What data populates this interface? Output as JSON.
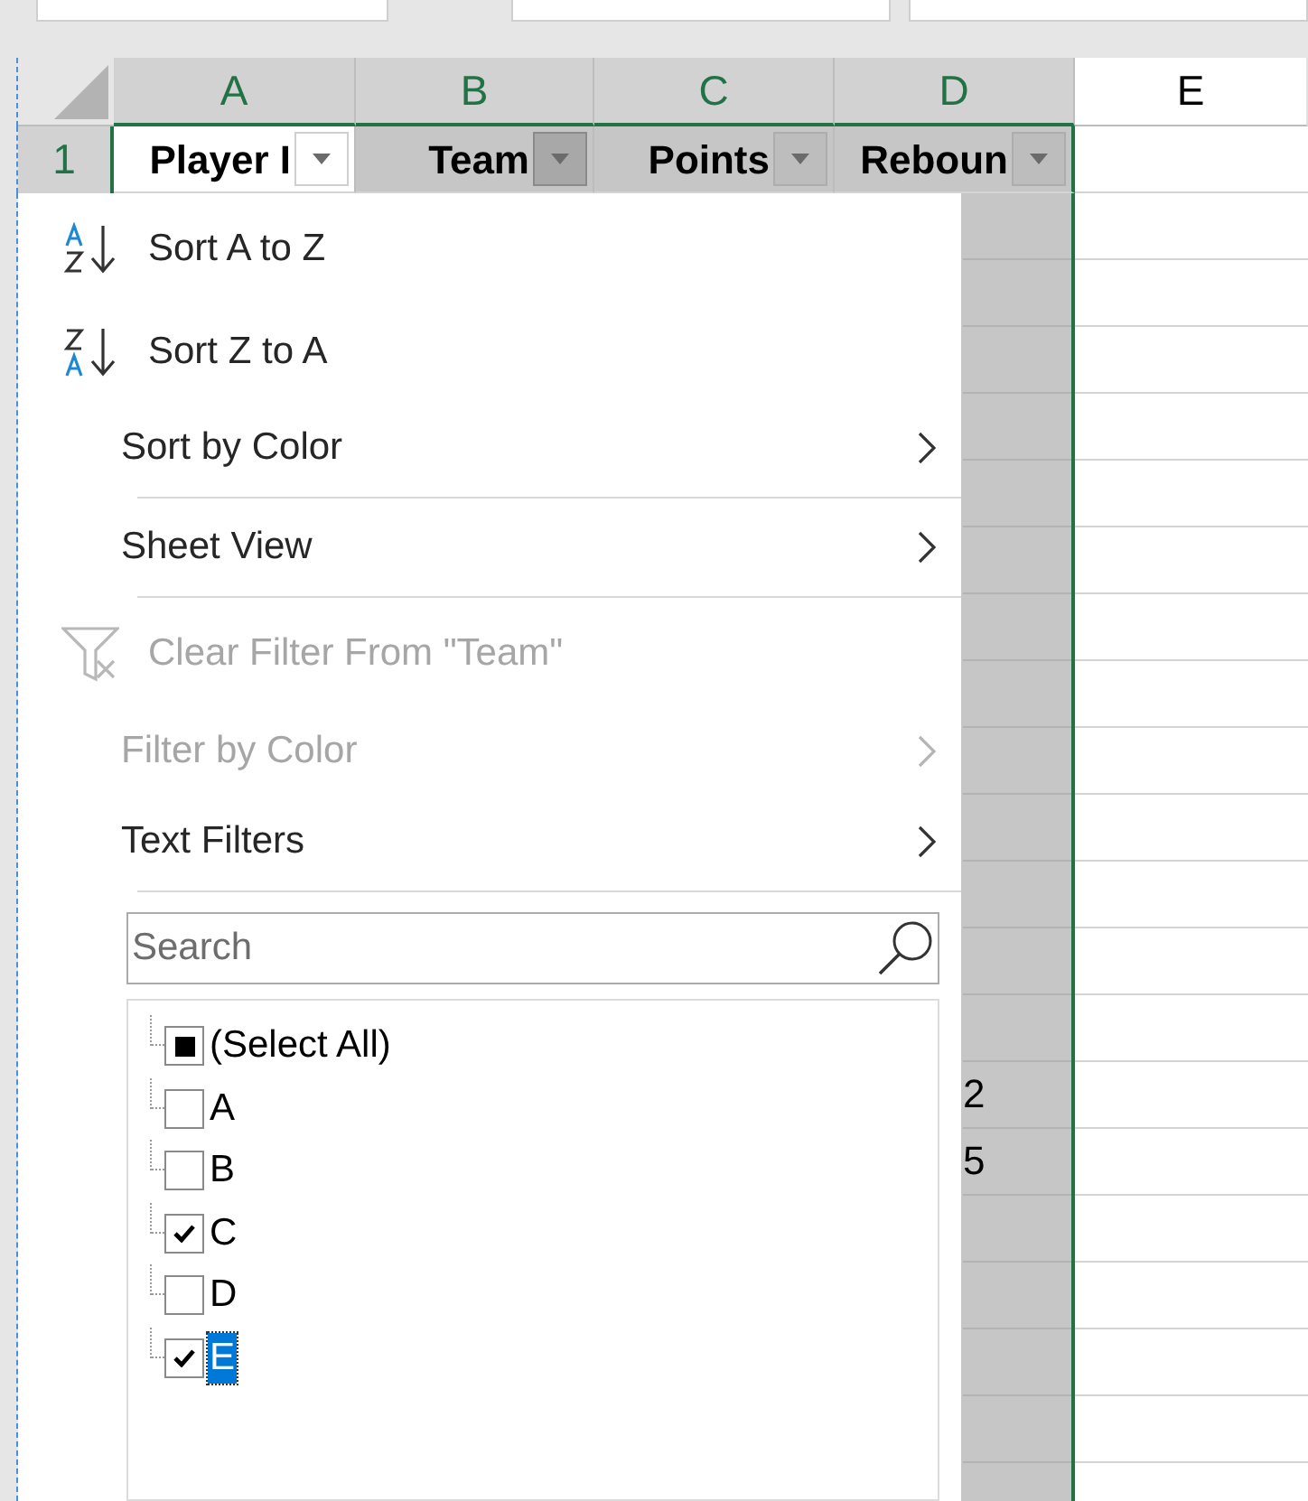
{
  "columns": [
    {
      "letter": "A",
      "selected": true
    },
    {
      "letter": "B",
      "selected": true
    },
    {
      "letter": "C",
      "selected": true
    },
    {
      "letter": "D",
      "selected": true
    },
    {
      "letter": "E",
      "selected": false
    }
  ],
  "header_row": {
    "number": "1",
    "cells": [
      {
        "text": "Player I",
        "filter_active": false
      },
      {
        "text": "Team",
        "filter_active": true
      },
      {
        "text": "Points",
        "filter_active": false
      },
      {
        "text": "Reboun",
        "filter_active": false
      }
    ]
  },
  "filter_menu": {
    "items": [
      {
        "kind": "sort_ascending",
        "label": "Sort A to Z",
        "disabled": false,
        "submenu": false
      },
      {
        "kind": "sort_descending",
        "label": "Sort Z to A",
        "disabled": false,
        "submenu": false
      },
      {
        "kind": "item",
        "label": "Sort by Color",
        "disabled": false,
        "submenu": true
      },
      {
        "kind": "separator"
      },
      {
        "kind": "item",
        "label": "Sheet View",
        "disabled": false,
        "submenu": true
      },
      {
        "kind": "separator"
      },
      {
        "kind": "clear",
        "label": "Clear Filter From \"Team\"",
        "disabled": true,
        "submenu": false
      },
      {
        "kind": "item",
        "label": "Filter by Color",
        "disabled": true,
        "submenu": true
      },
      {
        "kind": "item",
        "label": "Text Filters",
        "disabled": false,
        "submenu": true
      },
      {
        "kind": "separator"
      }
    ],
    "search": {
      "placeholder": "Search"
    },
    "values": [
      {
        "label": "(Select All)",
        "checked": false,
        "indeterminate": true,
        "selected": false
      },
      {
        "label": "A",
        "checked": false,
        "indeterminate": false,
        "selected": false
      },
      {
        "label": "B",
        "checked": false,
        "indeterminate": false,
        "selected": false
      },
      {
        "label": "C",
        "checked": true,
        "indeterminate": false,
        "selected": false
      },
      {
        "label": "D",
        "checked": false,
        "indeterminate": false,
        "selected": false
      },
      {
        "label": "E",
        "checked": true,
        "indeterminate": false,
        "selected": true
      }
    ]
  },
  "rows": [
    {},
    {},
    {},
    {},
    {},
    {},
    {},
    {},
    {},
    {},
    {},
    {},
    {},
    {
      "column_4": "2"
    },
    {
      "column_4": "5"
    },
    {},
    {},
    {},
    {},
    {}
  ]
}
